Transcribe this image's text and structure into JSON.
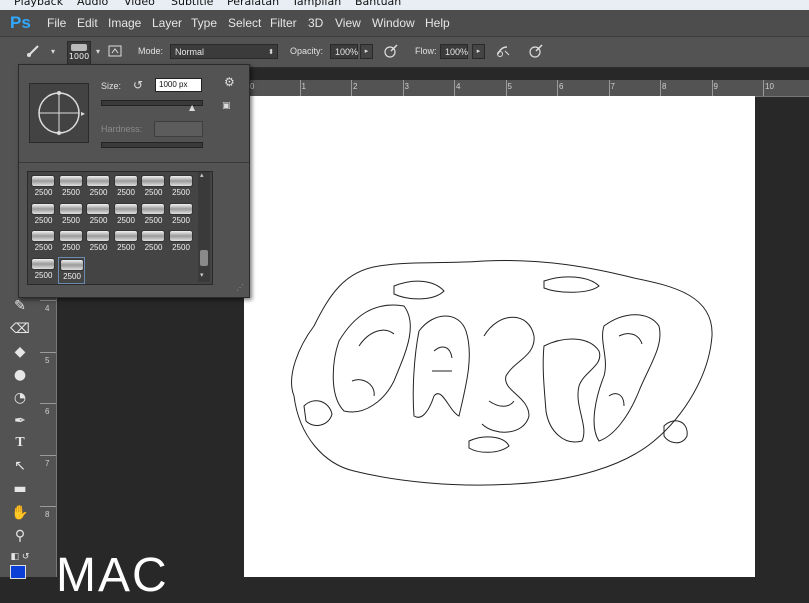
{
  "os_menu": [
    "Playback",
    "Audio",
    "Video",
    "Subtitle",
    "Peralatan",
    "Tampilan",
    "Bantuan"
  ],
  "app": {
    "logo": "Ps",
    "menus": [
      "File",
      "Edit",
      "Image",
      "Layer",
      "Type",
      "Select",
      "Filter",
      "3D",
      "View",
      "Window",
      "Help"
    ]
  },
  "options": {
    "brush_size": "1000",
    "mode_label": "Mode:",
    "mode_value": "Normal",
    "opacity_label": "Opacity:",
    "opacity_value": "100%",
    "flow_label": "Flow:",
    "flow_value": "100%"
  },
  "brush_panel": {
    "size_label": "Size:",
    "size_value": "1000 px",
    "hardness_label": "Hardness:",
    "presets": [
      "2500",
      "2500",
      "2500",
      "2500",
      "2500",
      "2500",
      "2500",
      "2500",
      "2500",
      "2500",
      "2500",
      "2500",
      "2500",
      "2500",
      "2500",
      "2500",
      "2500",
      "2500",
      "2500",
      "2500"
    ]
  },
  "rulers": {
    "h": [
      "0",
      "1",
      "2",
      "3",
      "4",
      "5",
      "6",
      "7",
      "8",
      "9",
      "10"
    ],
    "v": [
      "4",
      "5",
      "6",
      "7",
      "8"
    ]
  },
  "watermark": "MAC",
  "colors": {
    "accent": "#30a8ff",
    "foreground_swatch": "#0b3fd6"
  }
}
